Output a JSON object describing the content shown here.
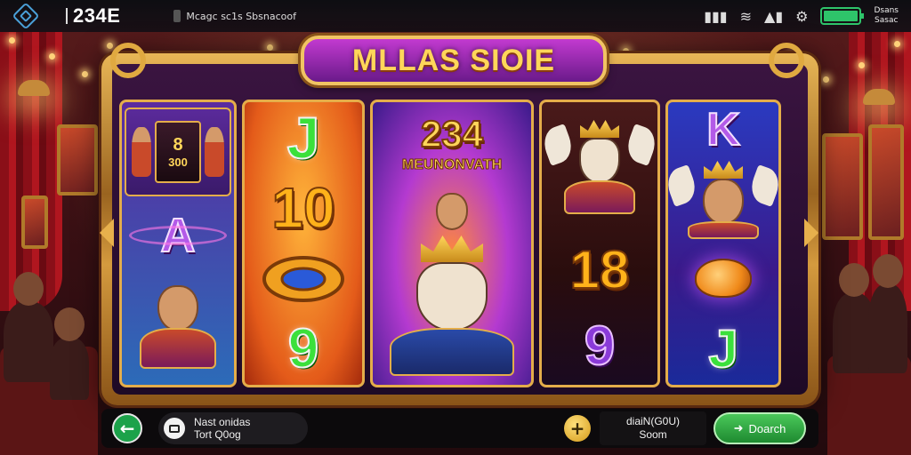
{
  "status_bar": {
    "app_title": "234E",
    "subtitle": "Mcagc sc1s Sbsnacoof",
    "icons": [
      "app-logo-icon",
      "signal-bars-icon",
      "wifi-icon",
      "network-icon",
      "settings-gear-icon",
      "battery-icon"
    ],
    "user_line1": "Dsans",
    "user_line2": "Sasac"
  },
  "game": {
    "title": "MLLAS SIOIE",
    "reels": {
      "reel1": {
        "mini_number": "8",
        "mini_caption": "300",
        "symbol": "A"
      },
      "reel2": {
        "symbols": [
          "J",
          "10",
          "9"
        ]
      },
      "reel3": {
        "number": "234",
        "caption": "MEUNONVATH"
      },
      "reel4": {
        "symbols": [
          "18",
          "9"
        ]
      },
      "reel5": {
        "symbols": [
          "K",
          "J"
        ]
      }
    }
  },
  "bottom_bar": {
    "back_icon": "arrow-left-icon",
    "info_line1": "Nast onidas",
    "info_line2": "Tort Q0og",
    "add_icon": "plus-icon",
    "balance_line1": "diaiN(G0U)",
    "balance_line2": "Soom",
    "action_label": "Doarch",
    "action_icon": "arrow-right-icon"
  },
  "colors": {
    "accent_gold": "#e4ad4a",
    "title_purple": "#c23ad0",
    "action_green": "#1ca24a",
    "battery_green": "#2ec46a"
  }
}
